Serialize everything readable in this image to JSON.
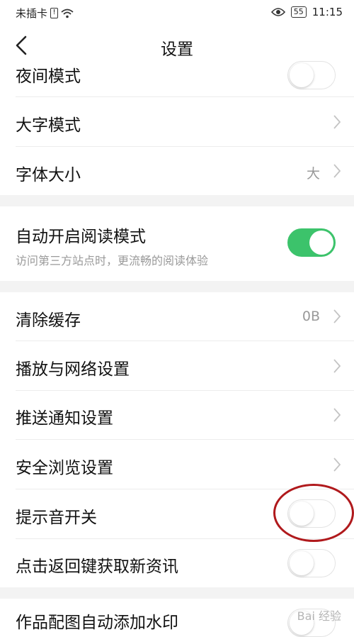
{
  "status_bar": {
    "carrier": "未插卡",
    "battery": "55",
    "time": "11:15"
  },
  "header": {
    "title": "设置"
  },
  "rows": {
    "night_mode": {
      "label": "夜间模式",
      "on": false
    },
    "large_text": {
      "label": "大字模式"
    },
    "font_size": {
      "label": "字体大小",
      "value": "大"
    },
    "auto_read": {
      "label": "自动开启阅读模式",
      "sub": "访问第三方站点时，更流畅的阅读体验",
      "on": true
    },
    "clear_cache": {
      "label": "清除缓存",
      "value": "0B"
    },
    "play_network": {
      "label": "播放与网络设置"
    },
    "push": {
      "label": "推送通知设置"
    },
    "safe_browse": {
      "label": "安全浏览设置"
    },
    "sound": {
      "label": "提示音开关",
      "on": false
    },
    "back_key": {
      "label": "点击返回键获取新资讯",
      "on": false
    },
    "watermark": {
      "label": "作品配图自动添加水印"
    }
  },
  "overlay": {
    "watermark_text": "Bai 经验"
  },
  "colors": {
    "toggle_on": "#3cc36b",
    "annotation": "#b0191c"
  }
}
